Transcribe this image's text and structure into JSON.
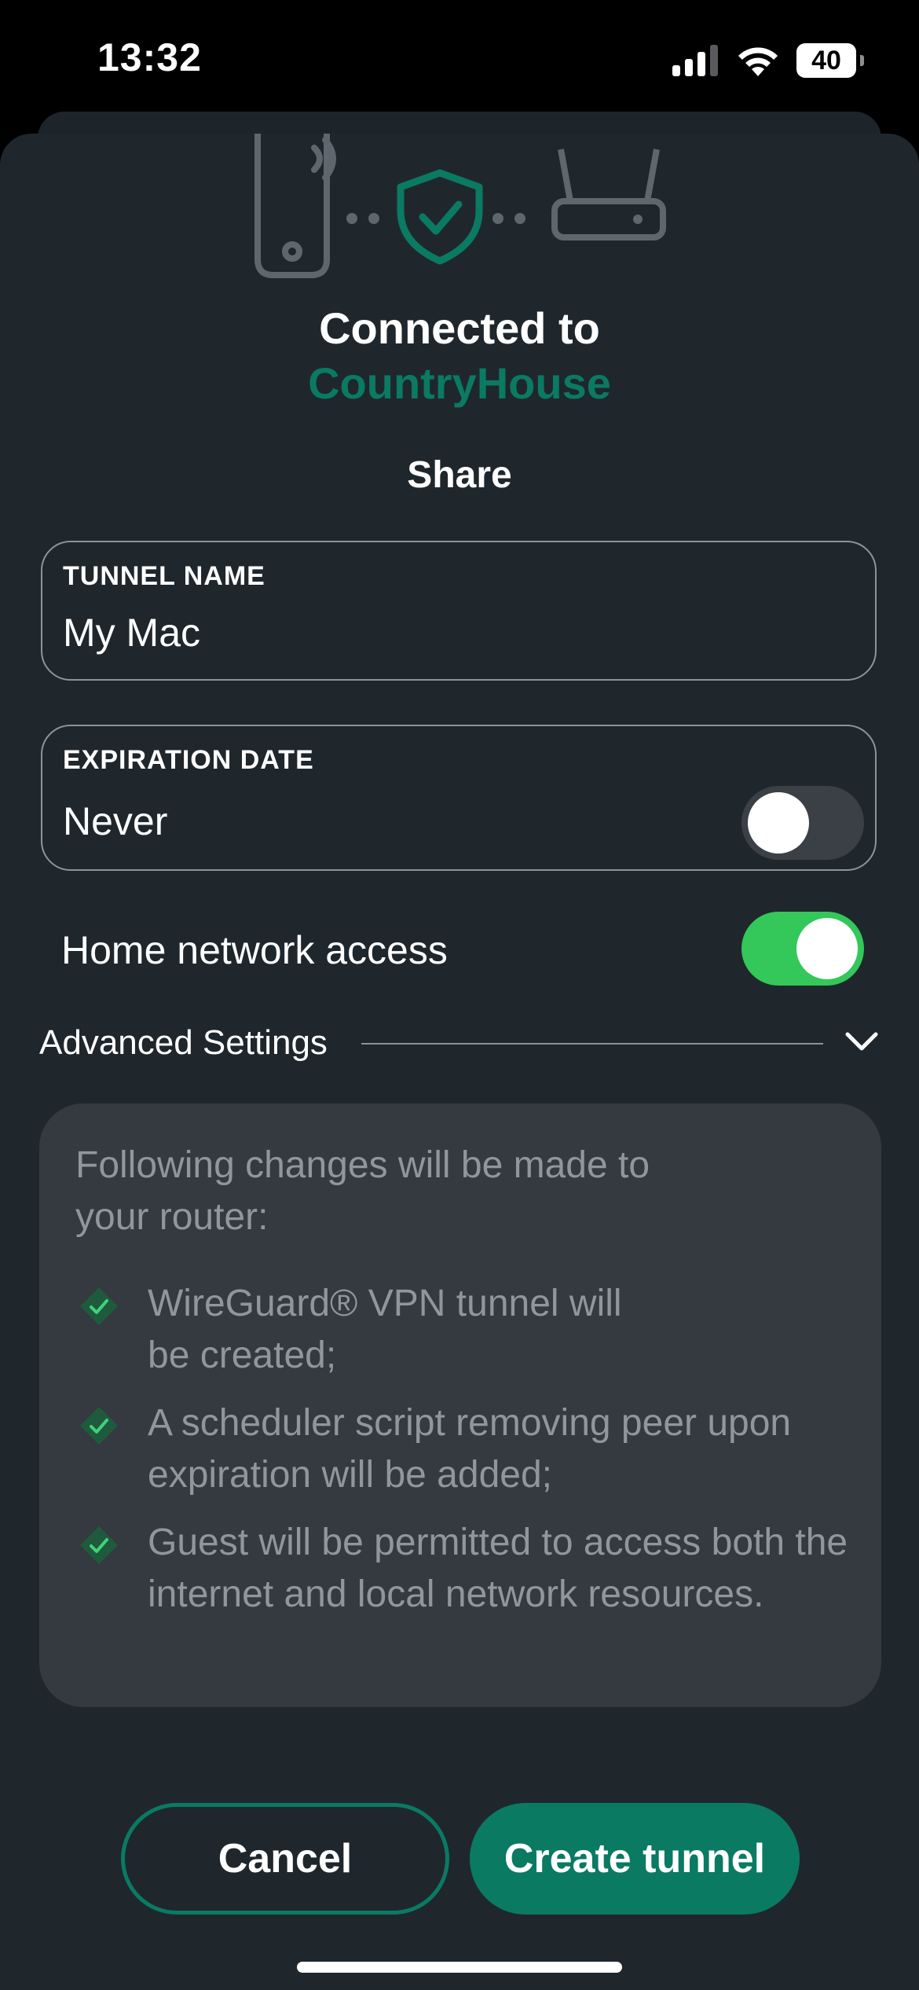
{
  "status_bar": {
    "time": "13:32",
    "battery": "40"
  },
  "header": {
    "title": "Connected to",
    "router_name": "CountryHouse",
    "section": "Share"
  },
  "tunnel_name": {
    "label": "TUNNEL NAME",
    "value": "My Mac"
  },
  "expiration": {
    "label": "EXPIRATION DATE",
    "value": "Never",
    "toggle_on": false
  },
  "home_access": {
    "label": "Home network access",
    "toggle_on": true
  },
  "advanced": {
    "label": "Advanced Settings"
  },
  "info": {
    "heading": "Following changes will be made to your router:",
    "items": [
      "WireGuard® VPN tunnel will be created;",
      "A scheduler script removing peer upon expiration will be added;",
      "Guest will be permitted to access both the internet and local network resources."
    ]
  },
  "buttons": {
    "cancel": "Cancel",
    "create": "Create tunnel"
  },
  "colors": {
    "accent": "#0a7a63",
    "toggle_on": "#34c759",
    "sheet_bg": "#1f272d",
    "card_bg": "#343a3f"
  }
}
